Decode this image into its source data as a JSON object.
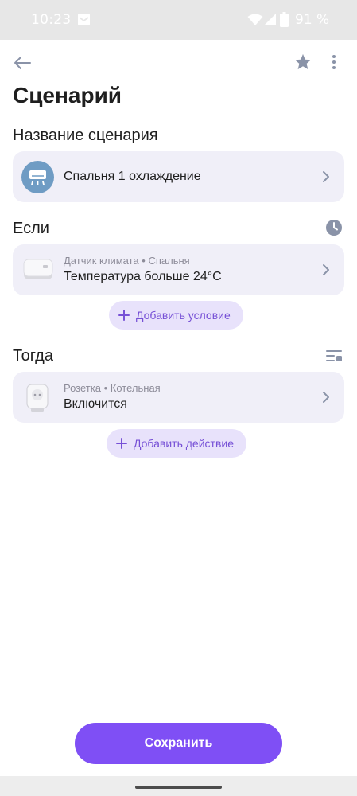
{
  "status_bar": {
    "time": "10:23",
    "battery_percent": "91 %"
  },
  "header": {
    "title": "Сценарий"
  },
  "name_section": {
    "label": "Название сценария",
    "value": "Спальня 1 охлаждение",
    "icon": "air-conditioner-icon"
  },
  "if_section": {
    "label": "Если",
    "condition": {
      "device": "Датчик климата",
      "separator": "•",
      "room": "Спальня",
      "title": "Температура больше 24°C",
      "icon": "climate-sensor-icon"
    },
    "add_label": "Добавить условие"
  },
  "then_section": {
    "label": "Тогда",
    "action": {
      "device": "Розетка",
      "separator": "•",
      "room": "Котельная",
      "title": "Включится",
      "icon": "smart-plug-icon"
    },
    "add_label": "Добавить действие"
  },
  "save_label": "Сохранить",
  "colors": {
    "accent": "#7f4ff5",
    "card_bg": "#f0eff8",
    "pill_bg": "#e8e2fb",
    "icon_gray": "#8a93a8",
    "status_bar_bg": "#e7e7e7"
  }
}
